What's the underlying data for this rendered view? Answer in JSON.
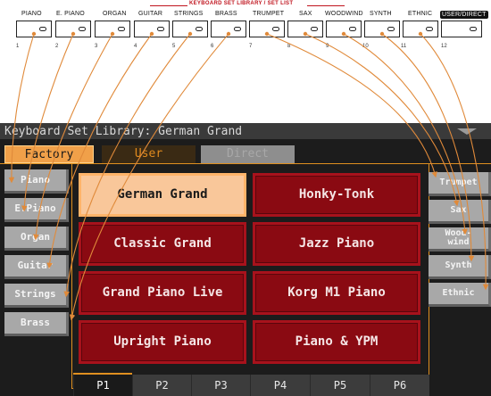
{
  "hardware_panel": {
    "header": "KEYBOARD SET LIBRARY / SET LIST",
    "buttons": [
      {
        "label": "PIANO",
        "number": "1"
      },
      {
        "label": "E. PIANO",
        "number": "2"
      },
      {
        "label": "ORGAN",
        "number": "3"
      },
      {
        "label": "GUITAR",
        "number": "4"
      },
      {
        "label": "STRINGS",
        "number": "5"
      },
      {
        "label": "BRASS",
        "number": "6"
      },
      {
        "label": "TRUMPET",
        "number": "7"
      },
      {
        "label": "SAX",
        "number": "8"
      },
      {
        "label": "WOODWIND",
        "number": "9"
      },
      {
        "label": "SYNTH",
        "number": "10"
      },
      {
        "label": "ETHNIC",
        "number": "11"
      },
      {
        "label": "USER/DIRECT",
        "number": "12"
      }
    ]
  },
  "screen": {
    "title": "Keyboard Set Library: German Grand",
    "source_tabs": [
      {
        "label": "Factory",
        "state": "selected"
      },
      {
        "label": "User",
        "state": "normal"
      },
      {
        "label": "Direct",
        "state": "disabled"
      }
    ],
    "left_categories": [
      "Piano",
      "E.Piano",
      "Organ",
      "Guitar",
      "Strings",
      "Brass"
    ],
    "right_categories": [
      {
        "label": "Trumpet"
      },
      {
        "label": "Sax"
      },
      {
        "label": "Wood-\nwind"
      },
      {
        "label": "Synth"
      },
      {
        "label": "Ethnic"
      }
    ],
    "keyboard_sets": [
      {
        "name": "German Grand",
        "selected": true
      },
      {
        "name": "Honky-Tonk",
        "selected": false
      },
      {
        "name": "Classic Grand",
        "selected": false
      },
      {
        "name": "Jazz Piano",
        "selected": false
      },
      {
        "name": "Grand Piano Live",
        "selected": false
      },
      {
        "name": "Korg M1 Piano",
        "selected": false
      },
      {
        "name": "Upright Piano",
        "selected": false
      },
      {
        "name": "Piano & YPM",
        "selected": false
      }
    ],
    "pages": [
      {
        "label": "P1",
        "selected": true
      },
      {
        "label": "P2",
        "selected": false
      },
      {
        "label": "P3",
        "selected": false
      },
      {
        "label": "P4",
        "selected": false
      },
      {
        "label": "P5",
        "selected": false
      },
      {
        "label": "P6",
        "selected": false
      }
    ]
  },
  "colors": {
    "accent_orange": "#e09020",
    "selected_set": "#f9c79a",
    "set_button": "#8a0a12",
    "callout_arrow": "#e08a3a",
    "panel_red": "#c0141e"
  }
}
